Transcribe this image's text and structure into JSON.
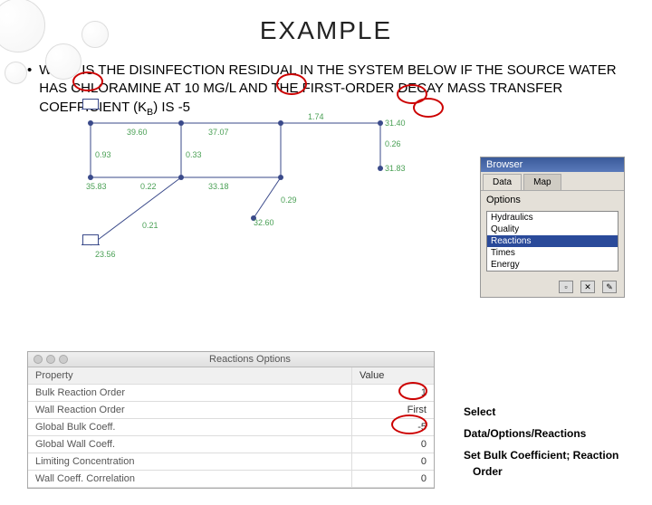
{
  "title": "EXAMPLE",
  "body_text_1": "WHAT IS THE DISINFECTION RESIDUAL IN THE SYSTEM BELOW IF THE SOURCE WATER HAS CHLORAMINE AT 10 MG/L AND THE FIRST-ORDER DECAY MASS TRANSFER COEFFICIENT (K",
  "body_text_sub": "B",
  "body_text_2": ") IS -5",
  "diagram": {
    "labels_green": [
      "39.60",
      "37.07",
      "1.74",
      "31.40",
      "0.26",
      "0.93",
      "0.33",
      "31.83",
      "0.22",
      "35.83",
      "33.18",
      "0.29",
      "32.60",
      "0.21",
      "23.56"
    ],
    "labels_blue": []
  },
  "browser": {
    "title": "Browser",
    "tab_data": "Data",
    "tab_map": "Map",
    "section": "Options",
    "items": [
      "Hydraulics",
      "Quality",
      "Reactions",
      "Times",
      "Energy"
    ],
    "selected": "Reactions"
  },
  "options_panel": {
    "title": "Reactions Options",
    "header_prop": "Property",
    "header_val": "Value",
    "rows": [
      {
        "label": "Bulk Reaction Order",
        "value": "1"
      },
      {
        "label": "Wall Reaction Order",
        "value": "First"
      },
      {
        "label": "Global Bulk Coeff.",
        "value": "-5"
      },
      {
        "label": "Global Wall Coeff.",
        "value": "0"
      },
      {
        "label": "Limiting Concentration",
        "value": "0"
      },
      {
        "label": "Wall Coeff. Correlation",
        "value": "0"
      }
    ]
  },
  "instructions": {
    "line1": "Select",
    "line2": "Data/Options/Reactions",
    "line3": "Set Bulk Coefficient; Reaction Order"
  }
}
